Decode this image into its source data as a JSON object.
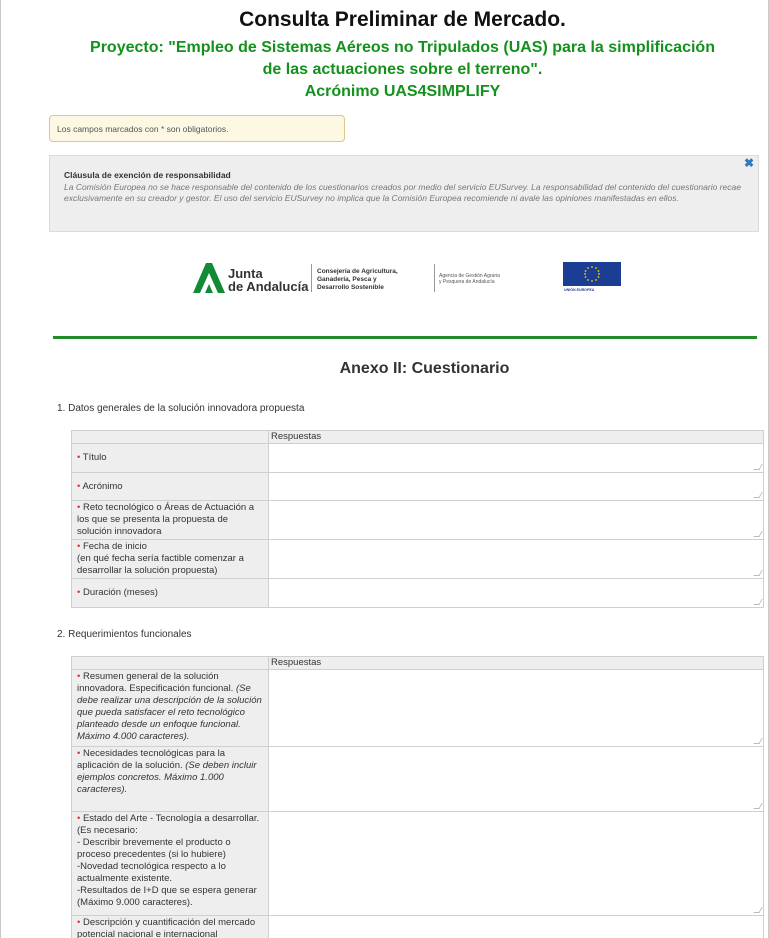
{
  "header": {
    "title": "Consulta Preliminar de Mercado.",
    "subtitle_line1": "Proyecto: \"Empleo de Sistemas Aéreos no Tripulados (UAS) para la simplificación",
    "subtitle_line2": "de las actuaciones sobre el terreno\".",
    "subtitle_line3": "Acrónimo UAS4SIMPLIFY"
  },
  "required_note": "Los campos marcados con * son obligatorios.",
  "disclaimer": {
    "title": "Cláusula de exención de responsabilidad",
    "text": "La Comisión Europea no se hace responsable del contenido de los cuestionarios creados por medio del servicio EUSurvey. La responsabilidad del contenido del cuestionario recae exclusivamente en su creador y gestor. El uso del servicio EUSurvey no implica que la Comisión Europea recomiende ni avale las opiniones manifestadas en ellos.",
    "close_glyph": "✖"
  },
  "logos": {
    "junta_line1": "Junta",
    "junta_line2": "de Andalucía",
    "consejeria_line1": "Consejería de Agricultura,",
    "consejeria_line2": "Ganadería, Pesca y",
    "consejeria_line3": "Desarrollo Sostenible",
    "agencia_line1": "Agencia de Gestión Agraria",
    "agencia_line2": "y Pesquera de Andalucía",
    "eu_label": "UNIÓN EUROPEA"
  },
  "colors": {
    "green": "#14911c",
    "accent_blue": "#2a7ac0",
    "required_red": "#d33"
  },
  "section_title": "Anexo II: Cuestionario",
  "q1": {
    "label": "1. Datos generales de la solución innovadora propuesta",
    "column_header": "Respuestas",
    "rows": [
      {
        "label": "Título"
      },
      {
        "label": "Acrónimo"
      },
      {
        "label": "Reto tecnológico o Áreas de Actuación a los que se presenta la propuesta de solución innovadora"
      },
      {
        "label": "Fecha de inicio",
        "note": "(en qué fecha sería factible comenzar a desarrollar la solución propuesta)"
      },
      {
        "label": "Duración (meses)"
      }
    ]
  },
  "q2": {
    "label": "2. Requerimientos funcionales",
    "column_header": "Respuestas",
    "rows": [
      {
        "label": "Resumen general de la solución innovadora. Especificación funcional.",
        "note": "(Se debe realizar una descripción de la solución que pueda satisfacer el reto tecnológico planteado desde un enfoque funcional. Máximo 4.000 caracteres)."
      },
      {
        "label": "Necesidades tecnológicas para la aplicación de la solución.",
        "note": "(Se deben incluir ejemplos concretos. Máximo 1.000 caracteres)."
      },
      {
        "label": "Estado del Arte - Tecnología a desarrollar. (Es necesario:",
        "l2": "- Describir brevemente el producto o proceso precedentes (si lo hubiere)",
        "l3": "-Novedad tecnológica respecto a lo actualmente existente.",
        "l4": "-Resultados de I+D que se espera generar (Máximo 9.000 caracteres)."
      },
      {
        "label": "Descripción y cuantificación del mercado potencial nacional e internacional"
      }
    ]
  }
}
